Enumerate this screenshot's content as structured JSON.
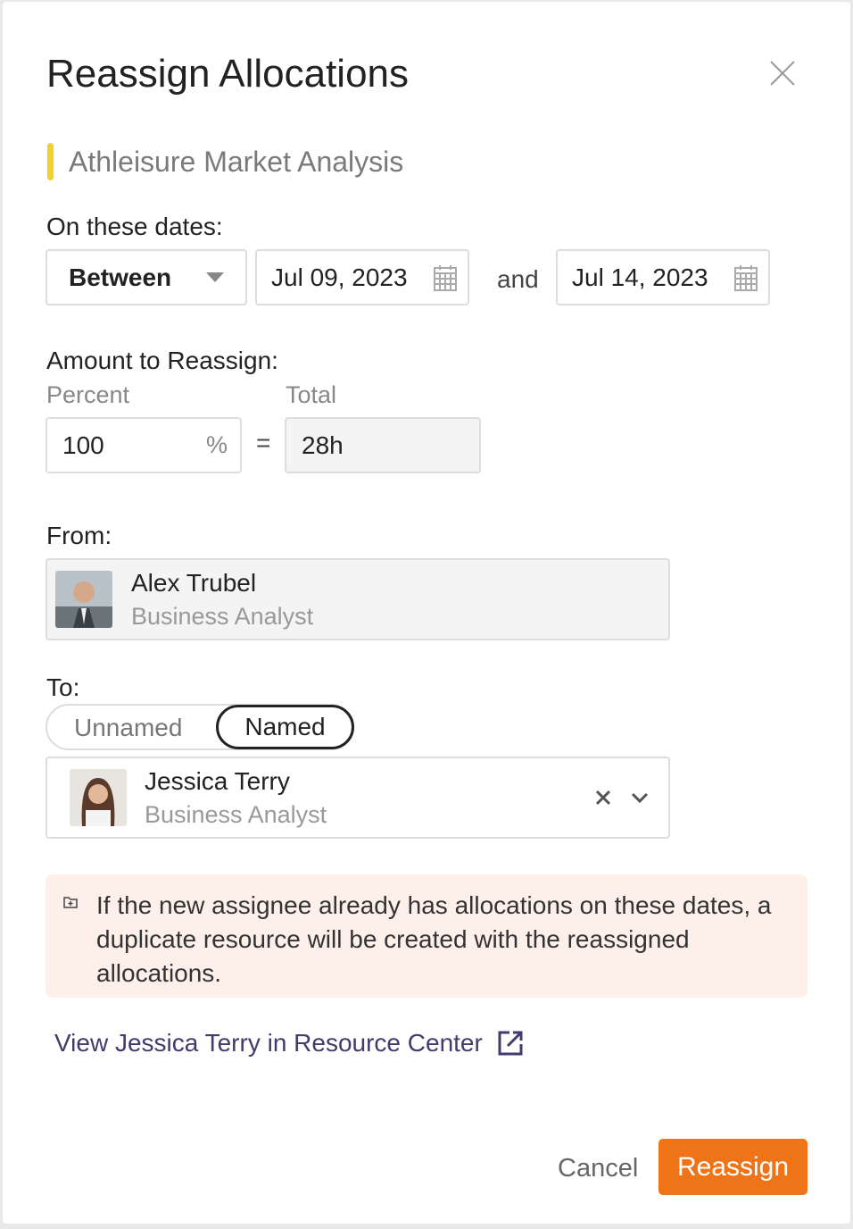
{
  "dialog": {
    "title": "Reassign Allocations",
    "project": "Athleisure Market Analysis",
    "project_color": "#f5cf2b"
  },
  "dates": {
    "label": "On these dates:",
    "mode": "Between",
    "start": "Jul 09, 2023",
    "joiner": "and",
    "end": "Jul 14, 2023"
  },
  "amount": {
    "label": "Amount to Reassign:",
    "percent_label": "Percent",
    "total_label": "Total",
    "percent_value": "100",
    "percent_unit": "%",
    "equals": "=",
    "total_value": "28h"
  },
  "from": {
    "label": "From:",
    "name": "Alex Trubel",
    "role": "Business Analyst"
  },
  "to": {
    "label": "To:",
    "toggle": [
      "Unnamed",
      "Named"
    ],
    "selected": "Named",
    "name": "Jessica Terry",
    "role": "Business Analyst"
  },
  "notice": {
    "text": "If the new assignee already has allocations on these dates, a duplicate resource will be created with the reassigned allocations."
  },
  "link": {
    "text": "View Jessica Terry in Resource Center",
    "color": "#433a6e"
  },
  "footer": {
    "cancel": "Cancel",
    "submit": "Reassign",
    "accent": "#ee7417"
  }
}
